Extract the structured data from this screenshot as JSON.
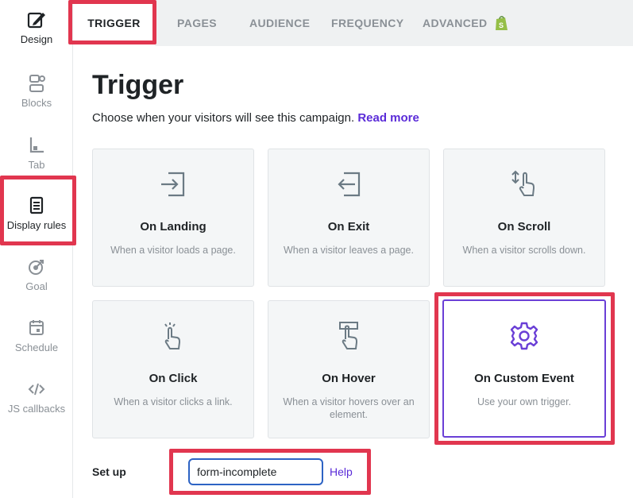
{
  "sidebar": {
    "items": [
      {
        "label": "Design",
        "icon": "design-icon"
      },
      {
        "label": "Blocks",
        "icon": "blocks-icon"
      },
      {
        "label": "Tab",
        "icon": "tab-icon"
      },
      {
        "label": "Display rules",
        "icon": "display-rules-icon"
      },
      {
        "label": "Goal",
        "icon": "goal-icon"
      },
      {
        "label": "Schedule",
        "icon": "schedule-icon"
      },
      {
        "label": "JS callbacks",
        "icon": "code-icon"
      }
    ]
  },
  "tabs": [
    {
      "label": "TRIGGER",
      "active": true
    },
    {
      "label": "PAGES"
    },
    {
      "label": "AUDIENCE"
    },
    {
      "label": "FREQUENCY"
    },
    {
      "label": "ADVANCED",
      "icon": "shopify-icon"
    }
  ],
  "main": {
    "title": "Trigger",
    "subtitle": "Choose when your visitors will see this campaign.",
    "read_more": "Read more"
  },
  "cards": [
    {
      "title": "On Landing",
      "desc": "When a visitor loads a page.",
      "icon": "enter-icon"
    },
    {
      "title": "On Exit",
      "desc": "When a visitor leaves a page.",
      "icon": "exit-icon"
    },
    {
      "title": "On Scroll",
      "desc": "When a visitor scrolls down.",
      "icon": "scroll-hand-icon"
    },
    {
      "title": "On Click",
      "desc": "When a visitor clicks a link.",
      "icon": "click-hand-icon"
    },
    {
      "title": "On Hover",
      "desc": "When a visitor hovers over an element.",
      "icon": "hover-hand-icon"
    },
    {
      "title": "On Custom Event",
      "desc": "Use your own trigger.",
      "icon": "gear-icon",
      "selected": true
    }
  ],
  "setup": {
    "label": "Set up",
    "value": "form-incomplete",
    "help": "Help"
  },
  "colors": {
    "accent": "#6a3fd6",
    "highlight": "#e1364f",
    "link": "#5a2bd8",
    "input_border": "#2d63c4"
  }
}
